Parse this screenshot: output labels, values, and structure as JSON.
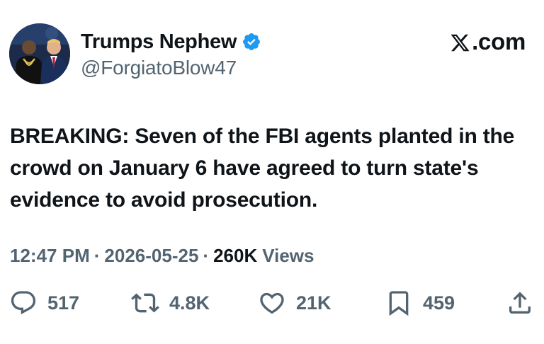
{
  "author": {
    "display_name": "Trumps Nephew",
    "handle": "@ForgiatoBlow47",
    "verified": true,
    "verified_color": "#1d9bf0"
  },
  "brand": {
    "label": ".com",
    "icon": "x-logo-icon"
  },
  "tweet": {
    "text": "BREAKING: Seven of the FBI agents planted in the crowd on January 6 have agreed to turn state's evidence to avoid prosecution."
  },
  "meta": {
    "time": "12:47 PM",
    "separator": "·",
    "date": "2026-05-25",
    "views_count": "260K",
    "views_label": "Views"
  },
  "actions": {
    "reply": {
      "icon": "reply-icon",
      "count": "517"
    },
    "retweet": {
      "icon": "retweet-icon",
      "count": "4.8K"
    },
    "like": {
      "icon": "heart-icon",
      "count": "21K"
    },
    "bookmark": {
      "icon": "bookmark-icon",
      "count": "459"
    },
    "share": {
      "icon": "share-icon"
    }
  },
  "colors": {
    "text_primary": "#0f1419",
    "text_secondary": "#536471",
    "background": "#ffffff"
  }
}
